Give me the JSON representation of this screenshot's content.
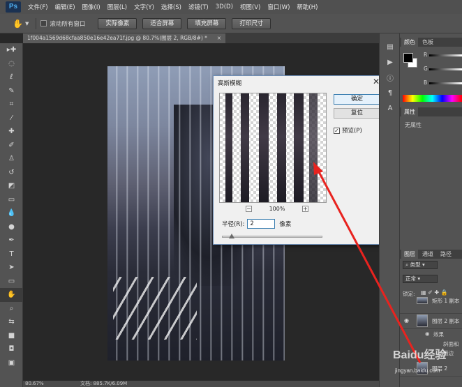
{
  "app": {
    "logo": "Ps"
  },
  "menu": [
    "文件(F)",
    "编辑(E)",
    "图像(I)",
    "图层(L)",
    "文字(Y)",
    "选择(S)",
    "滤镜(T)",
    "3D(D)",
    "视图(V)",
    "窗口(W)",
    "帮助(H)"
  ],
  "options": {
    "tool_icon": "hand-icon",
    "scroll_all_label": "滚动所有窗口",
    "buttons": [
      "实际像素",
      "适合屏幕",
      "填充屏幕",
      "打印尺寸"
    ]
  },
  "document": {
    "tab_title": "1f004a1569d68cfaa850e16e42ea71f.jpg @ 80.7%(图层 2, RGB/8#) *",
    "close_glyph": "×"
  },
  "dialog": {
    "title": "高斯模糊",
    "close_glyph": "✕",
    "ok_label": "确定",
    "reset_label": "复位",
    "preview_label": "预览(P)",
    "preview_checked": true,
    "zoom_out": "−",
    "zoom_value": "100%",
    "zoom_in": "+",
    "radius_label": "半径(R):",
    "radius_value": "2",
    "radius_unit": "像素"
  },
  "panels": {
    "color_tab": "颜色",
    "swatch_tab": "色板",
    "channels": [
      "R",
      "G",
      "B"
    ],
    "properties_tab": "属性",
    "properties_empty": "无属性",
    "layers_tabs": [
      "图层",
      "通道",
      "路径"
    ],
    "filter_kind": "类型",
    "blend_mode": "正常",
    "lock_label": "锁定:",
    "layers": [
      {
        "name": "矩形 1 副本"
      },
      {
        "name": "图层 2 副本"
      },
      {
        "name": "图层 2"
      }
    ],
    "effects_label": "效果",
    "effect_items": [
      "斜面和",
      "描边"
    ]
  },
  "status": {
    "zoom": "80.67%",
    "doc": "文档: 885.7K/6.09M"
  },
  "watermark": {
    "brand": "Baidu经验",
    "url": "jingyan.baidu.com"
  },
  "colors": {
    "annotation": "#e8231f",
    "dialog_border": "#6e8fb8",
    "accent": "#3c7fb1"
  }
}
